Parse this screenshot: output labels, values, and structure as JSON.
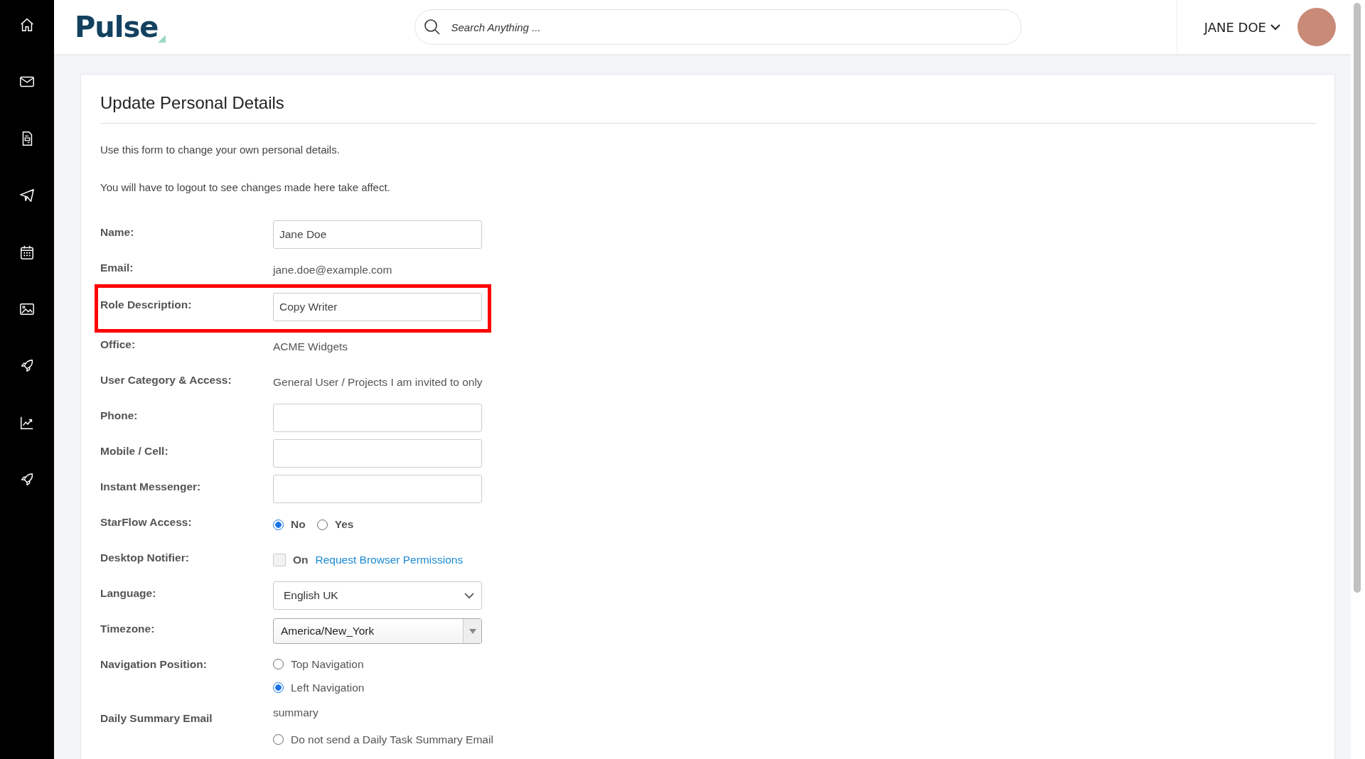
{
  "header": {
    "logo": "Pulse",
    "search": {
      "placeholder": "Search Anything ..."
    },
    "user": "JANE DOE"
  },
  "page": {
    "title": "Update Personal Details",
    "intro": [
      "Use this form to change your own personal details.",
      "You will have to logout to see changes made here take affect."
    ]
  },
  "fields": [
    {
      "kind": "input",
      "label": "Name:",
      "value": "Jane Doe"
    },
    {
      "kind": "text",
      "label": "Email:",
      "value": "jane.doe@example.com"
    },
    {
      "kind": "input",
      "label": "Role Description:",
      "value": "Copy Writer",
      "highlighted": true
    },
    {
      "kind": "text",
      "label": "Office:",
      "value": "ACME Widgets"
    },
    {
      "kind": "text",
      "label": "User Category & Access:",
      "value": "General User / Projects I am invited to only"
    },
    {
      "kind": "input",
      "label": "Phone:"
    },
    {
      "kind": "input",
      "label": "Mobile / Cell:"
    },
    {
      "kind": "input",
      "label": "Instant Messenger:"
    },
    {
      "kind": "radio",
      "label": "StarFlow Access:",
      "options": [
        {
          "label": "No",
          "selected": true
        },
        {
          "label": "Yes",
          "selected": false
        }
      ]
    },
    {
      "kind": "checkbox",
      "label": "Desktop Notifier:",
      "option": "On",
      "checked": false,
      "link": "Request Browser Permissions"
    },
    {
      "kind": "select",
      "label": "Language:",
      "value": "English UK"
    },
    {
      "kind": "combo",
      "label": "Timezone:",
      "value": "America/New_York"
    },
    {
      "kind": "radio-list",
      "label": "Navigation Position:",
      "options": [
        {
          "label": "Top Navigation",
          "selected": false
        },
        {
          "label": "Left Navigation",
          "selected": true
        }
      ]
    },
    {
      "kind": "text-radio",
      "label": "Daily Summary Email",
      "value": "summary",
      "options": [
        {
          "label": "Do not send a Daily Task Summary Email",
          "selected": false
        }
      ]
    }
  ]
}
